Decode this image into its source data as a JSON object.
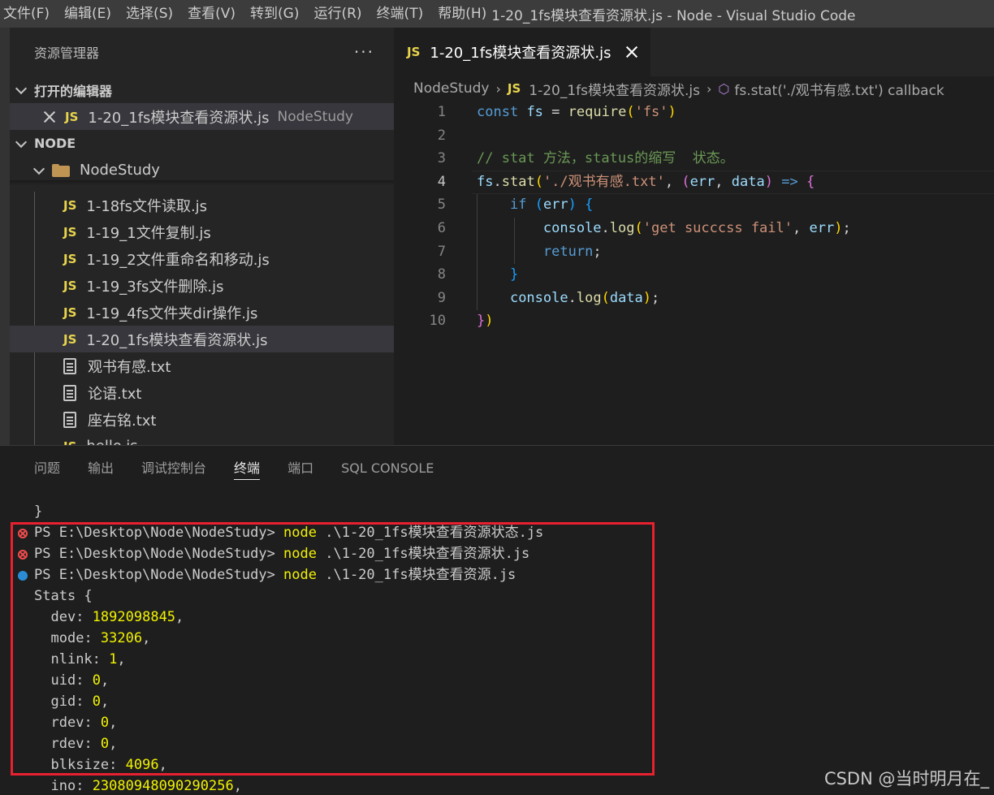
{
  "menu": {
    "items": [
      "文件(F)",
      "编辑(E)",
      "选择(S)",
      "查看(V)",
      "转到(G)",
      "运行(R)",
      "终端(T)",
      "帮助(H)"
    ],
    "window_title": "1-20_1fs模块查看资源状.js - Node - Visual Studio Code"
  },
  "sidebar": {
    "title": "资源管理器",
    "more": "···",
    "open_editors_label": "打开的编辑器",
    "open_editor": {
      "icon": "JS",
      "name": "1-20_1fs模块查看资源状.js",
      "folder": "NodeStudy"
    },
    "workspace_label": "NODE",
    "folder_name": "NodeStudy",
    "files": [
      {
        "icon": "JS",
        "name": "1-18fs文件读取.js"
      },
      {
        "icon": "JS",
        "name": "1-19_1文件复制.js"
      },
      {
        "icon": "JS",
        "name": "1-19_2文件重命名和移动.js"
      },
      {
        "icon": "JS",
        "name": "1-19_3fs文件删除.js"
      },
      {
        "icon": "JS",
        "name": "1-19_4fs文件夹dir操作.js"
      },
      {
        "icon": "JS",
        "name": "1-20_1fs模块查看资源状.js"
      },
      {
        "icon": "txt",
        "name": "观书有感.txt"
      },
      {
        "icon": "txt",
        "name": "论语.txt"
      },
      {
        "icon": "txt",
        "name": "座右铭.txt"
      },
      {
        "icon": "JS",
        "name": "hello.js"
      }
    ]
  },
  "editor": {
    "tab": {
      "icon": "JS",
      "label": "1-20_1fs模块查看资源状.js"
    },
    "breadcrumb": [
      "NodeStudy",
      "1-20_1fs模块查看资源状.js",
      "fs.stat('./观书有感.txt') callback"
    ],
    "breadcrumb_js_icon": "JS",
    "line_numbers": [
      "1",
      "2",
      "3",
      "4",
      "5",
      "6",
      "7",
      "8",
      "9",
      "10"
    ],
    "current_line": 4
  },
  "panel": {
    "tabs": [
      "问题",
      "输出",
      "调试控制台",
      "终端",
      "端口",
      "SQL CONSOLE"
    ],
    "active_tab": "终端",
    "terminal": {
      "close_brace": "}",
      "prompt": "PS E:\\Desktop\\Node\\NodeStudy> ",
      "commands": [
        {
          "status": "error",
          "cmd": "node",
          "arg": " .\\1-20_1fs模块查看资源状态.js"
        },
        {
          "status": "error",
          "cmd": "node",
          "arg": " .\\1-20_1fs模块查看资源状.js"
        },
        {
          "status": "success",
          "cmd": "node",
          "arg": " .\\1-20_1fs模块查看资源.js"
        }
      ],
      "stats_open": "Stats {",
      "stats": [
        {
          "key": "dev",
          "value": "1892098845"
        },
        {
          "key": "mode",
          "value": "33206"
        },
        {
          "key": "nlink",
          "value": "1"
        },
        {
          "key": "uid",
          "value": "0"
        },
        {
          "key": "gid",
          "value": "0"
        },
        {
          "key": "rdev",
          "value": "0"
        },
        {
          "key": "rdev",
          "value": "0"
        },
        {
          "key": "blksize",
          "value": "4096"
        },
        {
          "key": "ino",
          "value": "23080948090290256"
        }
      ]
    }
  },
  "watermark": "CSDN @当时明月在_",
  "colors": {
    "highlight_box": "#e8202f",
    "js_icon": "#e8d44d",
    "terminal_cmd": "#f2f200",
    "folder": "#c09553"
  }
}
